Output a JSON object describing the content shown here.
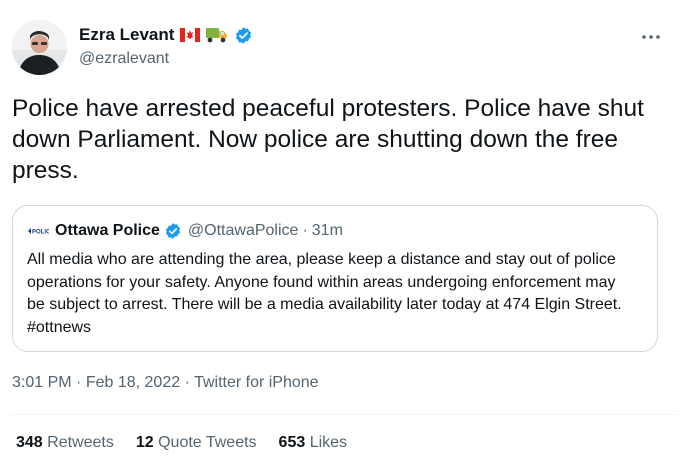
{
  "author": {
    "name": "Ezra Levant",
    "handle": "@ezralevant",
    "emoji_icons": [
      "canada-flag-icon",
      "truck-icon"
    ],
    "verified": true
  },
  "tweet": {
    "text": "Police have arrested peaceful protesters. Police have shut down Parliament. Now police are shutting down the free press."
  },
  "quoted": {
    "logo_text": "POLICE",
    "name": "Ottawa Police",
    "handle": "@OttawaPolice",
    "separator": "·",
    "age": "31m",
    "text": "All media who are attending the area, please keep a distance and stay out of police operations for your safety. Anyone found within areas undergoing enforcement may be subject to arrest. There will be a media availability later today at 474 Elgin Street. #ottnews"
  },
  "meta": {
    "time": "3:01 PM",
    "date": "Feb 18, 2022",
    "source": "Twitter for iPhone",
    "separator": "·"
  },
  "stats": {
    "retweets_count": "348",
    "retweets_label": "Retweets",
    "quotes_count": "12",
    "quotes_label": "Quote Tweets",
    "likes_count": "653",
    "likes_label": "Likes"
  },
  "colors": {
    "verified_blue": "#1d9bf0",
    "secondary_text": "#536471",
    "border": "#cfd9de"
  }
}
